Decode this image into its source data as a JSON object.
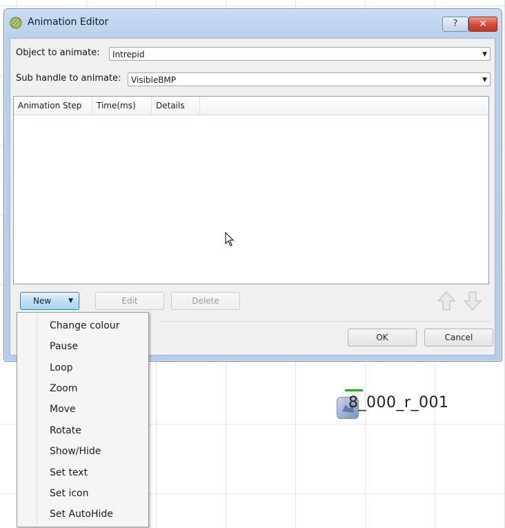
{
  "window": {
    "title": "Animation Editor",
    "help_label": "?",
    "close_label": "✕"
  },
  "form": {
    "object_label": "Object to animate:",
    "object_value": "Intrepid",
    "subhandle_label": "Sub handle to animate:",
    "subhandle_value": "VisibleBMP"
  },
  "list": {
    "columns": [
      "Animation Step",
      "Time(ms)",
      "Details"
    ],
    "rows": []
  },
  "buttons": {
    "new_label": "New",
    "edit_label": "Edit",
    "delete_label": "Delete",
    "ok_label": "OK",
    "cancel_label": "Cancel"
  },
  "new_menu": {
    "items": [
      "Change colour",
      "Pause",
      "Loop",
      "Zoom",
      "Move",
      "Rotate",
      "Show/Hide",
      "Set text",
      "Set icon",
      "Set AutoHide"
    ]
  },
  "canvas": {
    "object_label": "8_000_r_001"
  },
  "colors": {
    "title_bar": "#b9d1ea",
    "close_button": "#d3492f",
    "new_button": "#bcdff5",
    "canvas_marker": "#22b022"
  }
}
